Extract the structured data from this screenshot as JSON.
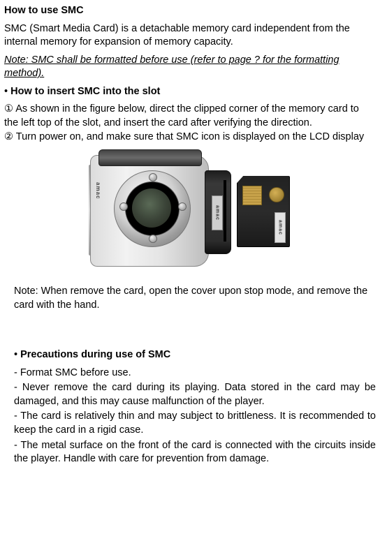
{
  "title": "How to use SMC",
  "intro": "SMC (Smart Media Card) is a detachable memory card independent from the internal memory for expansion of memory capacity.",
  "note_format": "Note: SMC shall be formatted before use (refer to page ? for the formatting method).",
  "insert": {
    "heading_bullet": "•",
    "heading": "How to insert SMC into the slot",
    "step1_marker": "①",
    "step1_text": "As shown in the figure below, direct the clipped corner of the memory card to the left top of the slot, and insert the card after verifying the direction.",
    "step2_marker": "②",
    "step2_text": "Turn power on, and make sure that SMC icon is displayed on the LCD display"
  },
  "figure": {
    "brand": "amac",
    "slot_label": "amac",
    "card_label": "amac"
  },
  "remove_note": "Note: When remove the card, open the cover upon stop mode, and remove the card with the hand.",
  "precautions": {
    "heading_bullet": "•",
    "heading": "Precautions during use of SMC",
    "items": [
      "- Format SMC before use.",
      "- Never remove the card during its playing. Data stored in the card may be damaged, and this may cause malfunction of the player.",
      "- The card is relatively thin and may subject to brittleness. It is recommended to keep the card in a rigid case.",
      "- The metal surface on the front of the card is connected with the circuits inside the player. Handle with care for prevention from damage."
    ]
  }
}
